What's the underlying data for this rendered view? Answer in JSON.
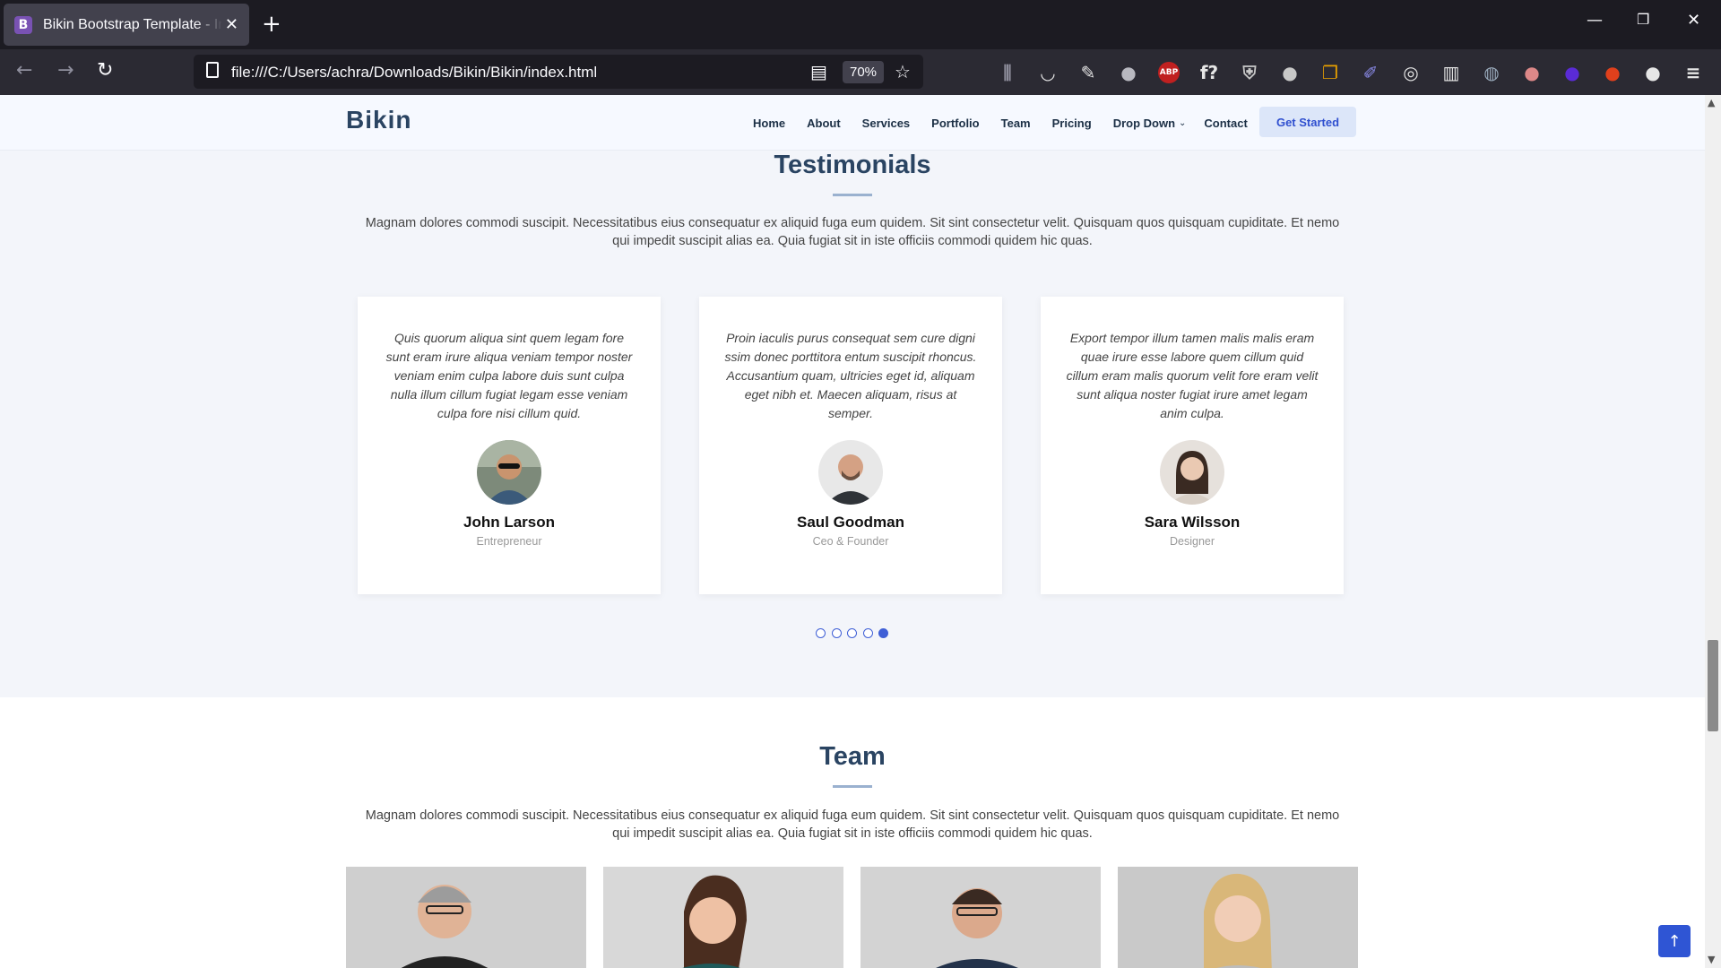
{
  "browser": {
    "tab_title": "Bikin Bootstrap Template - Index",
    "tab_favicon": "B",
    "url": "file:///C:/Users/achra/Downloads/Bikin/Bikin/index.html",
    "zoom": "70%",
    "extensions": [
      "library-icon",
      "pocket-icon",
      "wrench-icon",
      "ext-icon",
      "abp-icon",
      "fontface-icon",
      "shield-icon",
      "ext-icon",
      "copy-icon",
      "pen-icon",
      "instagram-icon",
      "columns-icon",
      "globe-icon",
      "ext-icon",
      "ext-icon",
      "ext-icon",
      "ext-icon",
      "menu-icon"
    ]
  },
  "site": {
    "logo": "Bikin",
    "nav": [
      "Home",
      "About",
      "Services",
      "Portfolio",
      "Team",
      "Pricing",
      "Drop Down",
      "Contact"
    ],
    "cta": "Get Started"
  },
  "testimonials": {
    "title": "Testimonials",
    "description": "Magnam dolores commodi suscipit. Necessitatibus eius consequatur ex aliquid fuga eum quidem. Sit sint consectetur velit. Quisquam quos quisquam cupiditate. Et nemo qui impedit suscipit alias ea. Quia fugiat sit in iste officiis commodi quidem hic quas.",
    "items": [
      {
        "quote": "Quis quorum aliqua sint quem legam fore sunt eram irure aliqua veniam tempor noster veniam enim culpa labore duis sunt culpa nulla illum cillum fugiat legam esse veniam culpa fore nisi cillum quid.",
        "name": "John Larson",
        "role": "Entrepreneur"
      },
      {
        "quote": "Proin iaculis purus consequat sem cure digni ssim donec porttitora entum suscipit rhoncus. Accusantium quam, ultricies eget id, aliquam eget nibh et. Maecen aliquam, risus at semper.",
        "name": "Saul Goodman",
        "role": "Ceo & Founder"
      },
      {
        "quote": "Export tempor illum tamen malis malis eram quae irure esse labore quem cillum quid cillum eram malis quorum velit fore eram velit sunt aliqua noster fugiat irure amet legam anim culpa.",
        "name": "Sara Wilsson",
        "role": "Designer"
      }
    ],
    "pagination": {
      "count": 5,
      "active_index": 4
    }
  },
  "team": {
    "title": "Team",
    "description": "Magnam dolores commodi suscipit. Necessitatibus eius consequatur ex aliquid fuga eum quidem. Sit sint consectetur velit. Quisquam quos quisquam cupiditate. Et nemo qui impedit suscipit alias ea. Quia fugiat sit in iste officiis commodi quidem hic quas."
  },
  "colors": {
    "accent": "#3f5fd6",
    "heading": "#2a4462",
    "background": "#f3f5fa"
  }
}
